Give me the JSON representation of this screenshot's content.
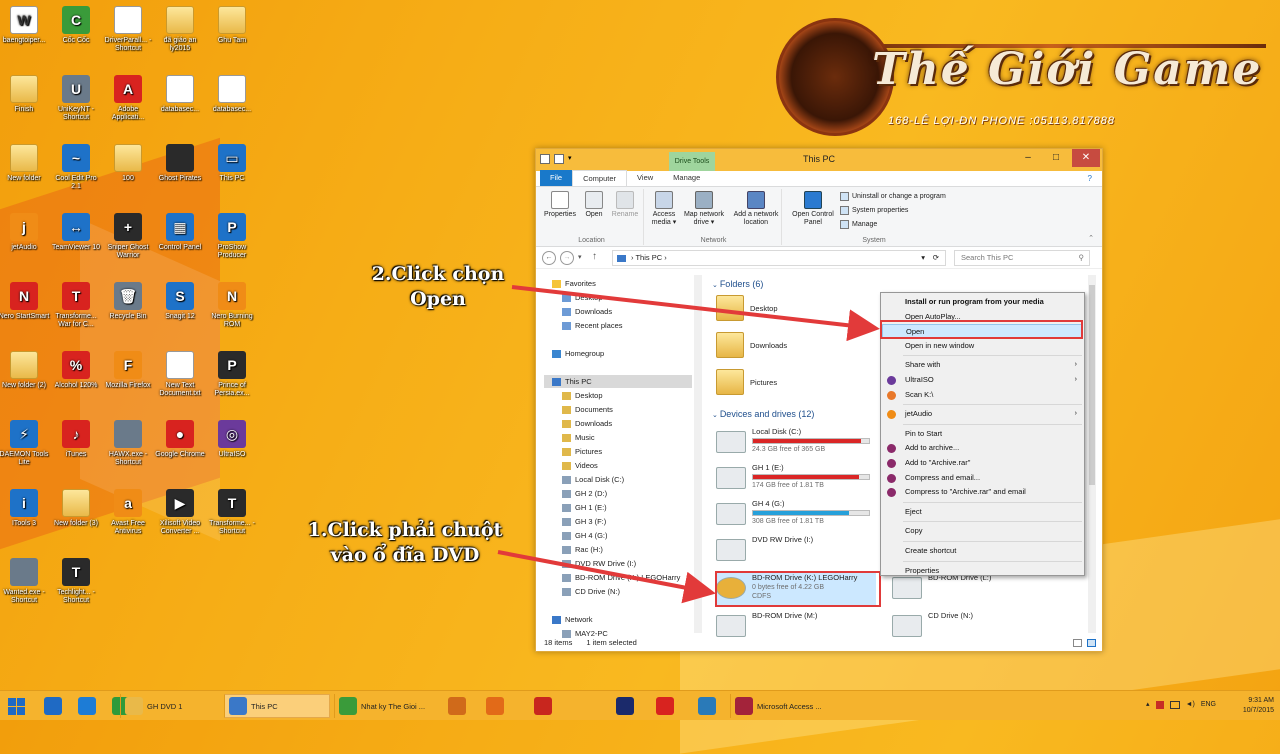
{
  "desktop_icons": [
    {
      "label": "baengtoiper...",
      "glyph": "W",
      "style": "g-doc"
    },
    {
      "label": "Cốc Cốc",
      "glyph": "C",
      "style": "g-green"
    },
    {
      "label": "DriverParall... - Shortcut",
      "glyph": "",
      "style": "g-doc"
    },
    {
      "label": "đã giáo an ly2015",
      "glyph": "",
      "style": "g-folder"
    },
    {
      "label": "Ghu Tam",
      "glyph": "",
      "style": "g-folder"
    },
    {
      "label": "Finish",
      "glyph": "",
      "style": "g-folder"
    },
    {
      "label": "UniKeyNT - Shortcut",
      "glyph": "U",
      "style": "g-grey"
    },
    {
      "label": "Adobe Applicati...",
      "glyph": "A",
      "style": "g-red"
    },
    {
      "label": "databasec...",
      "glyph": "",
      "style": "g-doc"
    },
    {
      "label": "databasec...",
      "glyph": "",
      "style": "g-doc"
    },
    {
      "label": "New folder",
      "glyph": "",
      "style": "g-folder"
    },
    {
      "label": "Cool Edit Pro 2.1",
      "glyph": "~",
      "style": "g-blue"
    },
    {
      "label": "100",
      "glyph": "",
      "style": "g-folder"
    },
    {
      "label": "Ghost Pirates",
      "glyph": "",
      "style": "g-dark"
    },
    {
      "label": "This PC",
      "glyph": "▭",
      "style": "g-blue"
    },
    {
      "label": "jetAudio",
      "glyph": "j",
      "style": "g-orange"
    },
    {
      "label": "TeamViewer 10",
      "glyph": "↔",
      "style": "g-blue"
    },
    {
      "label": "Sniper Ghost Warrior",
      "glyph": "+",
      "style": "g-dark"
    },
    {
      "label": "Control Panel",
      "glyph": "▦",
      "style": "g-blue"
    },
    {
      "label": "ProShow Producer",
      "glyph": "P",
      "style": "g-blue"
    },
    {
      "label": "Nero StartSmart",
      "glyph": "N",
      "style": "g-red"
    },
    {
      "label": "Transforme... War for C...",
      "glyph": "T",
      "style": "g-red"
    },
    {
      "label": "Recycle Bin",
      "glyph": "🗑",
      "style": "g-grey"
    },
    {
      "label": "Snagit 12",
      "glyph": "S",
      "style": "g-blue"
    },
    {
      "label": "Nero Burning ROM",
      "glyph": "N",
      "style": "g-orange"
    },
    {
      "label": "New folder (2)",
      "glyph": "",
      "style": "g-folder"
    },
    {
      "label": "Alcohol 120%",
      "glyph": "%",
      "style": "g-red"
    },
    {
      "label": "Mozilla Firefox",
      "glyph": "F",
      "style": "g-orange"
    },
    {
      "label": "New Text Document.txt",
      "glyph": "",
      "style": "g-doc"
    },
    {
      "label": "Prince of Persia.ex...",
      "glyph": "P",
      "style": "g-dark"
    },
    {
      "label": "DAEMON Tools Lite",
      "glyph": "⚡",
      "style": "g-blue"
    },
    {
      "label": "iTunes",
      "glyph": "♪",
      "style": "g-red"
    },
    {
      "label": "HAWX.exe - Shortcut",
      "glyph": "",
      "style": "g-grey"
    },
    {
      "label": "Google Chrome",
      "glyph": "●",
      "style": "g-red"
    },
    {
      "label": "UltraISO",
      "glyph": "◎",
      "style": "g-purple"
    },
    {
      "label": "ITools 3",
      "glyph": "i",
      "style": "g-blue"
    },
    {
      "label": "New folder (3)",
      "glyph": "",
      "style": "g-folder"
    },
    {
      "label": "Avast Free Antivirus",
      "glyph": "a",
      "style": "g-orange"
    },
    {
      "label": "Xilisoft Video Converter ...",
      "glyph": "▶",
      "style": "g-dark"
    },
    {
      "label": "Transforme... - Shortcut",
      "glyph": "T",
      "style": "g-dark"
    },
    {
      "label": "Wanted.exe - Shortcut",
      "glyph": "",
      "style": "g-grey"
    },
    {
      "label": "Techlight... - Shortcut",
      "glyph": "T",
      "style": "g-dark"
    }
  ],
  "logo": {
    "title": "Thế Giới Game",
    "subtitle": "168-LÊ LỢI-ĐN      PHONE :05113.817888"
  },
  "explorer": {
    "title": "This PC",
    "context_tab": "Drive Tools",
    "tabs": [
      "File",
      "Computer",
      "View",
      "Manage"
    ],
    "ribbon": {
      "location": {
        "label": "Location",
        "buttons": [
          "Properties",
          "Open",
          "Rename"
        ]
      },
      "network": {
        "label": "Network",
        "buttons": [
          "Access media ▾",
          "Map network drive ▾",
          "Add a network location"
        ]
      },
      "system": {
        "label": "System",
        "open_cp": "Open Control Panel",
        "links": [
          "Uninstall or change a program",
          "System properties",
          "Manage"
        ]
      }
    },
    "address": "This PC",
    "search_placeholder": "Search This PC",
    "nav": {
      "favorites": "Favorites",
      "fav_items": [
        "Desktop",
        "Downloads",
        "Recent places"
      ],
      "homegroup": "Homegroup",
      "thispc": "This PC",
      "pc_items": [
        "Desktop",
        "Documents",
        "Downloads",
        "Music",
        "Pictures",
        "Videos",
        "Local Disk (C:)",
        "GH 2 (D:)",
        "GH 1 (E:)",
        "GH 3 (F:)",
        "GH 4 (G:)",
        "Rac (H:)",
        "DVD RW Drive (I:)",
        "BD-ROM Drive (K:) LEGOHarry",
        "CD Drive (N:)"
      ],
      "network": "Network",
      "network_items": [
        "MAY2-PC"
      ]
    },
    "folders_header": "Folders (6)",
    "folders": [
      "Desktop",
      "Downloads",
      "Pictures"
    ],
    "drives_header": "Devices and drives (12)",
    "drives": [
      {
        "name": "Local Disk (C:)",
        "free": "24.3 GB free of 365 GB",
        "used_pct": 93,
        "color": "#da2626"
      },
      {
        "name": "GH 1 (E:)",
        "free": "174 GB free of 1.81 TB",
        "used_pct": 91,
        "color": "#da2626"
      },
      {
        "name": "GH 4 (G:)",
        "free": "308 GB free of 1.81 TB",
        "used_pct": 83,
        "color": "#26a0da"
      },
      {
        "name": "DVD RW Drive (I:)",
        "free": "",
        "used_pct": 0,
        "color": "#26a0da"
      },
      {
        "name": "BD-ROM Drive (K:) LEGOHarry",
        "free": "0 bytes free of 4.22 GB",
        "fs": "CDFS",
        "used_pct": 0,
        "color": "#26a0da"
      },
      {
        "name": "BD-ROM Drive (M:)",
        "free": "",
        "used_pct": 0,
        "color": "#26a0da"
      },
      {
        "name": "BD-ROM Drive (L:)",
        "free": "",
        "used_pct": 0,
        "color": "#26a0da"
      },
      {
        "name": "CD Drive (N:)",
        "free": "",
        "used_pct": 0,
        "color": "#26a0da"
      }
    ],
    "status": {
      "count": "18 items",
      "selected": "1 item selected"
    }
  },
  "context_menu": [
    {
      "label": "Install or run program from your media",
      "bold": true
    },
    {
      "label": "Open AutoPlay..."
    },
    {
      "label": "Open",
      "highlight": true
    },
    {
      "label": "Open in new window"
    },
    {
      "sep": true
    },
    {
      "label": "Share with",
      "sub": true
    },
    {
      "label": "UltraISO",
      "sub": true,
      "icon": "#6b3a9b"
    },
    {
      "label": "Scan K:\\",
      "icon": "#e8782a"
    },
    {
      "sep": true
    },
    {
      "label": "jetAudio",
      "sub": true,
      "icon": "#f08c16"
    },
    {
      "sep": true
    },
    {
      "label": "Pin to Start"
    },
    {
      "label": "Add to archive...",
      "icon": "#8b2a6a"
    },
    {
      "label": "Add to \"Archive.rar\"",
      "icon": "#8b2a6a"
    },
    {
      "label": "Compress and email...",
      "icon": "#8b2a6a"
    },
    {
      "label": "Compress to \"Archive.rar\" and email",
      "icon": "#8b2a6a"
    },
    {
      "sep": true
    },
    {
      "label": "Eject"
    },
    {
      "sep": true
    },
    {
      "label": "Copy"
    },
    {
      "sep": true
    },
    {
      "label": "Create shortcut"
    },
    {
      "sep": true
    },
    {
      "label": "Properties"
    }
  ],
  "annotations": {
    "step2": "2.Click chọn\nOpen",
    "step1": "1.Click phải chuột\nvào ổ đĩa DVD"
  },
  "taskbar": {
    "items": [
      {
        "label": "",
        "color": "#1f6ac4"
      },
      {
        "label": "",
        "color": "#1d7cd6"
      },
      {
        "label": "",
        "color": "#2f9a3a"
      },
      {
        "label": "GH DVD 1",
        "color": "#e9b949",
        "win": false
      },
      {
        "label": "This PC",
        "color": "#3a78c8",
        "win": true
      },
      {
        "label": "Nhat ky The Gioi ...",
        "color": "#3a9b3a",
        "win": false
      },
      {
        "label": "",
        "color": "#d06a1a"
      },
      {
        "label": "",
        "color": "#e26a18"
      },
      {
        "label": "",
        "color": "#c8261e"
      },
      {
        "label": "",
        "color": "#1b2a6b"
      },
      {
        "label": "",
        "color": "#d8231f"
      },
      {
        "label": "",
        "color": "#2a7ab8"
      },
      {
        "label": "Microsoft Access ...",
        "color": "#a3233a",
        "win": false
      }
    ],
    "lang": "ENG",
    "time": "9:31 AM",
    "date": "10/7/2015"
  }
}
